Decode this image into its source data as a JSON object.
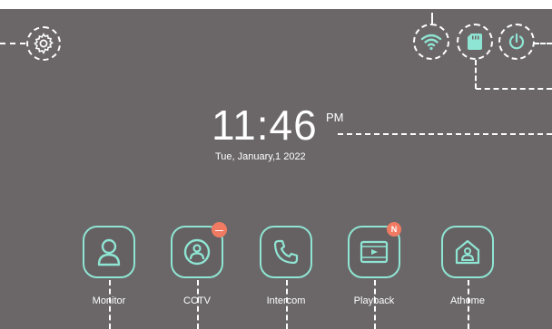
{
  "clock": {
    "time": "11:46",
    "ampm": "PM",
    "date": "Tue, January,1 2022"
  },
  "top_icons": [
    "gear-icon",
    "wifi-icon",
    "sd-card-icon",
    "power-icon"
  ],
  "apps": [
    {
      "label": "Monitor",
      "icon": "person-icon"
    },
    {
      "label": "CCTV",
      "icon": "camera-person-icon",
      "badge": "—"
    },
    {
      "label": "Intercom",
      "icon": "phone-icon"
    },
    {
      "label": "Playback",
      "icon": "film-play-icon",
      "badge": "N"
    },
    {
      "label": "Athome",
      "icon": "home-person-icon"
    }
  ],
  "colors": {
    "background": "#6b6769",
    "accent": "#8fe5d3",
    "badge": "#f07a62",
    "text": "#ffffff"
  }
}
